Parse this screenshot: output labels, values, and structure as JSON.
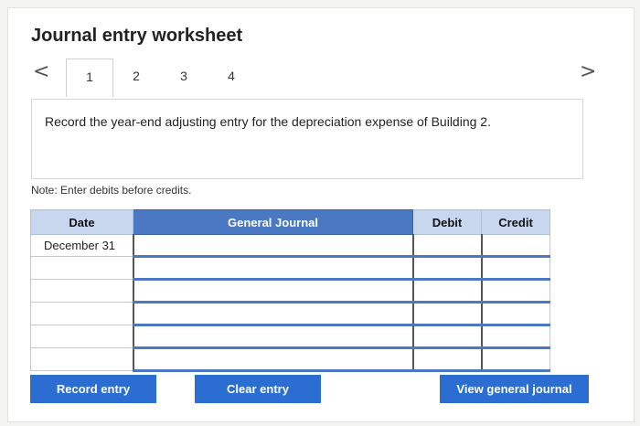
{
  "title": "Journal entry worksheet",
  "nav": {
    "prev": "<",
    "next": ">"
  },
  "tabs": [
    {
      "label": "1",
      "active": true
    },
    {
      "label": "2",
      "active": false
    },
    {
      "label": "3",
      "active": false
    },
    {
      "label": "4",
      "active": false
    }
  ],
  "instruction": "Record the year-end adjusting entry for the depreciation expense of Building 2.",
  "note": "Note: Enter debits before credits.",
  "table": {
    "headers": {
      "date": "Date",
      "general_journal": "General Journal",
      "debit": "Debit",
      "credit": "Credit"
    },
    "rows": [
      {
        "date": "December 31",
        "account": "",
        "debit": "",
        "credit": ""
      },
      {
        "date": "",
        "account": "",
        "debit": "",
        "credit": ""
      },
      {
        "date": "",
        "account": "",
        "debit": "",
        "credit": ""
      },
      {
        "date": "",
        "account": "",
        "debit": "",
        "credit": ""
      },
      {
        "date": "",
        "account": "",
        "debit": "",
        "credit": ""
      },
      {
        "date": "",
        "account": "",
        "debit": "",
        "credit": ""
      }
    ]
  },
  "buttons": {
    "record": "Record entry",
    "clear": "Clear entry",
    "view": "View general journal"
  },
  "colors": {
    "accent": "#2b6dd0",
    "header": "#4a78c2",
    "header_light": "#c9d7ee"
  }
}
